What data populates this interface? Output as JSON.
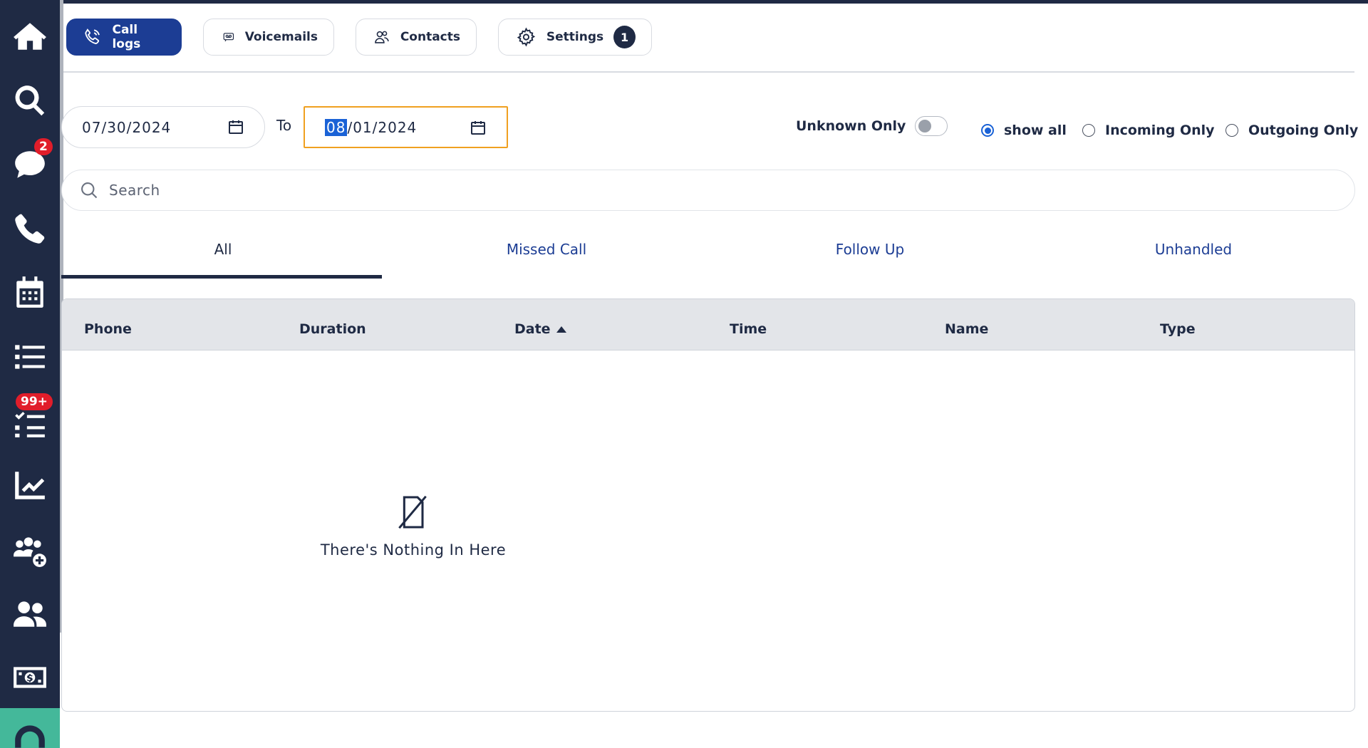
{
  "sidebar": {
    "items": [
      {
        "icon": "home-icon"
      },
      {
        "icon": "search-icon"
      },
      {
        "icon": "chat-icon",
        "badge": "2"
      },
      {
        "icon": "phone-icon"
      },
      {
        "icon": "calendar-icon"
      },
      {
        "icon": "list-icon"
      },
      {
        "icon": "task-list-icon",
        "badge": "99+"
      },
      {
        "icon": "analytics-icon"
      },
      {
        "icon": "add-user-group-icon"
      },
      {
        "icon": "users-icon"
      },
      {
        "icon": "money-icon"
      },
      {
        "icon": "headset-icon"
      }
    ]
  },
  "header": {
    "call_logs_label": "Call logs",
    "voicemails_label": "Voicemails",
    "contacts_label": "Contacts",
    "settings_label": "Settings",
    "settings_count": "1"
  },
  "filters": {
    "date_from": "07/30/2024",
    "date_to_month": "08",
    "date_to_rest": "/01/2024",
    "to_label": "To",
    "unknown_only_label": "Unknown Only",
    "unknown_only_on": false,
    "radio_show_all": "show all",
    "radio_incoming": "Incoming Only",
    "radio_outgoing": "Outgoing Only",
    "selected_radio": "show all"
  },
  "search": {
    "placeholder": "Search"
  },
  "tabs": [
    {
      "label": "All",
      "active": true
    },
    {
      "label": "Missed Call",
      "active": false
    },
    {
      "label": "Follow Up",
      "active": false
    },
    {
      "label": "Unhandled",
      "active": false
    }
  ],
  "table": {
    "columns": [
      "Phone",
      "Duration",
      "Date",
      "Time",
      "Name",
      "Type"
    ],
    "sorted_column": "Date",
    "sort_direction": "ascending",
    "rows": [],
    "empty_message": "There's Nothing In Here"
  },
  "colors": {
    "sidebar": "#1f2a44",
    "accent": "#1c3d94",
    "badge": "#e11d2a",
    "focus": "#f0a020"
  }
}
